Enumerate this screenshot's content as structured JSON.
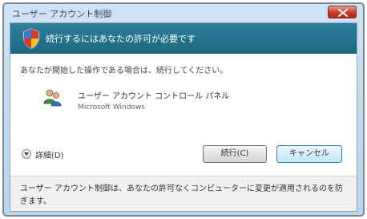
{
  "window": {
    "title": "ユーザー アカウント制御"
  },
  "banner": {
    "text": "続行するにはあなたの許可が必要です"
  },
  "content": {
    "instruction": "あなたが開始した操作である場合は、続行してください。",
    "program_name": "ユーザー アカウント コントロール パネル",
    "publisher": "Microsoft Windows"
  },
  "details": {
    "label": "詳細(D)"
  },
  "buttons": {
    "continue_label": "続行(C)",
    "cancel_label": "キャンセル"
  },
  "footer": {
    "text": "ユーザー アカウント制御は、あなたの許可なくコンピューターに変更が適用されるのを防ぎます。"
  },
  "icons": {
    "close": "close-icon",
    "shield": "shield-icon",
    "program": "user-accounts-icon",
    "details": "chevron-down-icon"
  },
  "colors": {
    "banner": "#1a6680",
    "frame": "#b9d4ec",
    "close_button": "#c8402a"
  }
}
